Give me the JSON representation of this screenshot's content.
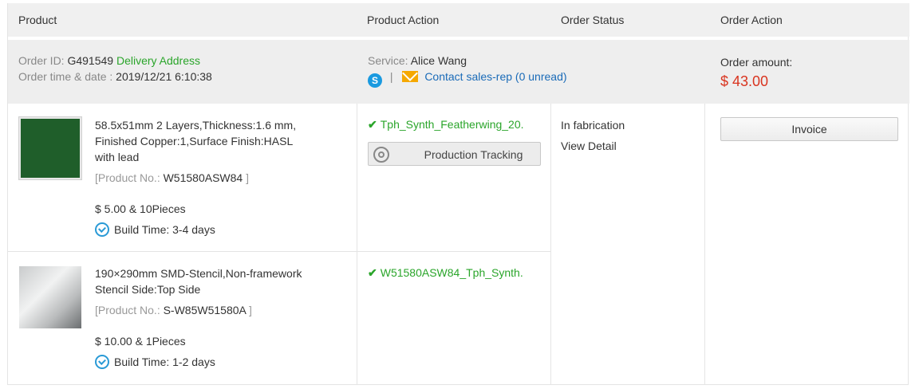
{
  "header": {
    "product": "Product",
    "product_action": "Product Action",
    "order_status": "Order Status",
    "order_action": "Order Action"
  },
  "order": {
    "id_label": "Order ID:",
    "id_value": "G491549",
    "delivery_address_link": "Delivery Address",
    "time_label": "Order time & date :",
    "time_value": "2019/12/21 6:10:38",
    "service_label": "Service:",
    "service_name": "Alice Wang",
    "separator": "|",
    "contact_link": "Contact sales-rep (0 unread)",
    "amount_label": "Order amount:",
    "amount_value": "$ 43.00"
  },
  "items": [
    {
      "desc_line1": "58.5x51mm 2 Layers,Thickness:1.6 mm,",
      "desc_line2": "Finished Copper:1,Surface Finish:HASL",
      "desc_line3": "with lead",
      "product_no_label": "[Product No.:",
      "product_no": "W51580ASW84",
      "product_no_close": "]",
      "price": "$ 5.00 & 10Pieces",
      "build_time": "Build Time: 3-4 days",
      "file": "Tph_Synth_Featherwing_20.",
      "tracking_button": "Production Tracking"
    },
    {
      "desc_line1": "190×290mm SMD-Stencil,Non-framework",
      "desc_line2": "Stencil Side:Top Side",
      "product_no_label": "[Product No.:",
      "product_no": "S-W85W51580A",
      "product_no_close": "]",
      "price": "$ 10.00 & 1Pieces",
      "build_time": "Build Time: 1-2 days",
      "file": "W51580ASW84_Tph_Synth."
    }
  ],
  "status": {
    "text": "In fabrication",
    "detail_link": "View Detail"
  },
  "actions": {
    "invoice_button": "Invoice"
  },
  "icons": {
    "check": "check-icon",
    "gear": "gear-icon",
    "clock": "build-time-icon",
    "skype": "skype-icon",
    "mail": "mail-icon"
  },
  "colors": {
    "green": "#2aa52a",
    "blue": "#1a6bb8",
    "red": "#d9341f",
    "header_bg": "#f0f0f0"
  }
}
